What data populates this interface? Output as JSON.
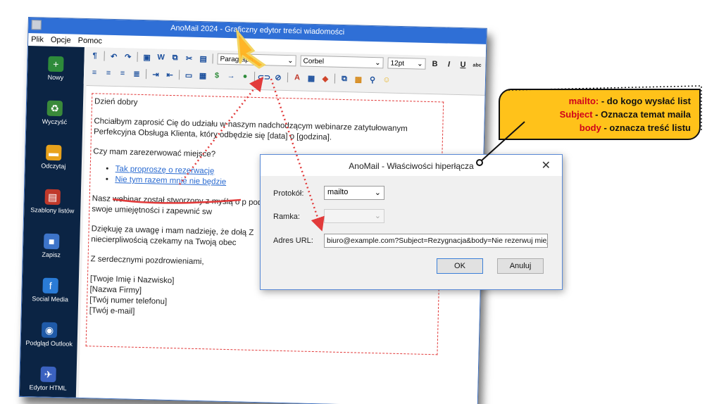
{
  "window": {
    "title": "AnoMail 2024 - Graficzny edytor treści wiadomości"
  },
  "menu": {
    "items": [
      "Plik",
      "Opcje",
      "Pomoc"
    ]
  },
  "sidebar": {
    "items": [
      {
        "label": "Nowy",
        "icon": "new-plus-icon",
        "color": "#2e8b3a"
      },
      {
        "label": "Wyczyść",
        "icon": "recycle-icon",
        "color": "#3a8a3a"
      },
      {
        "label": "Odczytaj",
        "icon": "folder-open-icon",
        "color": "#e8a21c"
      },
      {
        "label": "Szablony listów",
        "icon": "templates-icon",
        "color": "#c0392b"
      },
      {
        "label": "Zapisz",
        "icon": "floppy-save-icon",
        "color": "#3d74c9"
      },
      {
        "label": "Social Media",
        "icon": "social-media-icon",
        "color": "#2a7bd6"
      },
      {
        "label": "Podgląd Outlook",
        "icon": "outlook-preview-icon",
        "color": "#1f5aa8"
      },
      {
        "label": "Edytor HTML",
        "icon": "html-editor-icon",
        "color": "#3b62c0"
      }
    ]
  },
  "toolbar": {
    "paragraph_style": "Paragraph",
    "font": "Corbel",
    "size": "12pt",
    "bold": "B",
    "italic": "I",
    "underline": "U",
    "strike": "abc"
  },
  "editor": {
    "greeting": "Dzień dobry",
    "intro": "Chciałbym zaprosić Cię do udziału w naszym nadchodzącym webinarze zatytułowanym Perfekcyjna Obsługa Klienta, który odbędzie się [data] o [godzina].",
    "question": "Czy mam zarezerwować miejsce?",
    "link_yes": "Tak proproszę o rezerwację",
    "link_no": "Nie tym razem mnie nie będzie",
    "about": "Nasz webinar został stworzony z myślą o p podnieść swoje umiejętności i zapewnić sw",
    "thanks": "Dziękuję za uwagę i mam nadzieję, że dołą Z niecierpliwością czekamy na Twoją obec",
    "regards": "Z serdecznymi pozdrowieniami,",
    "sig_name": "[Twoje Imię i Nazwisko]",
    "sig_company": "[Nazwa Firmy]",
    "sig_phone": "[Twój numer telefonu]",
    "sig_email": "[Twój e-mail]"
  },
  "dialog": {
    "title": "AnoMail - Właściwości hiperłącza",
    "protocol_label": "Protokół:",
    "protocol_value": "mailto",
    "frame_label": "Ramka:",
    "frame_value": "",
    "url_label": "Adres URL:",
    "url_value": "biuro@example.com?Subject=Rezygnacja&body=Nie rezerwuj miejsc",
    "ok_label": "OK",
    "cancel_label": "Anuluj"
  },
  "callout": {
    "line1_key": "mailto:",
    "line1_text": " - do kogo wysłać list",
    "line2_key": "Subject",
    "line2_text": " - Oznacza temat maila",
    "line3_key": "body",
    "line3_text": " - oznacza treść listu"
  },
  "colors": {
    "titlebar": "#2f6fd6",
    "sidebar": "#0b2444",
    "callout": "#ffc21a",
    "callout_key": "#d0021b",
    "annotation_red": "#e23b3b",
    "link": "#2a6bd1"
  }
}
